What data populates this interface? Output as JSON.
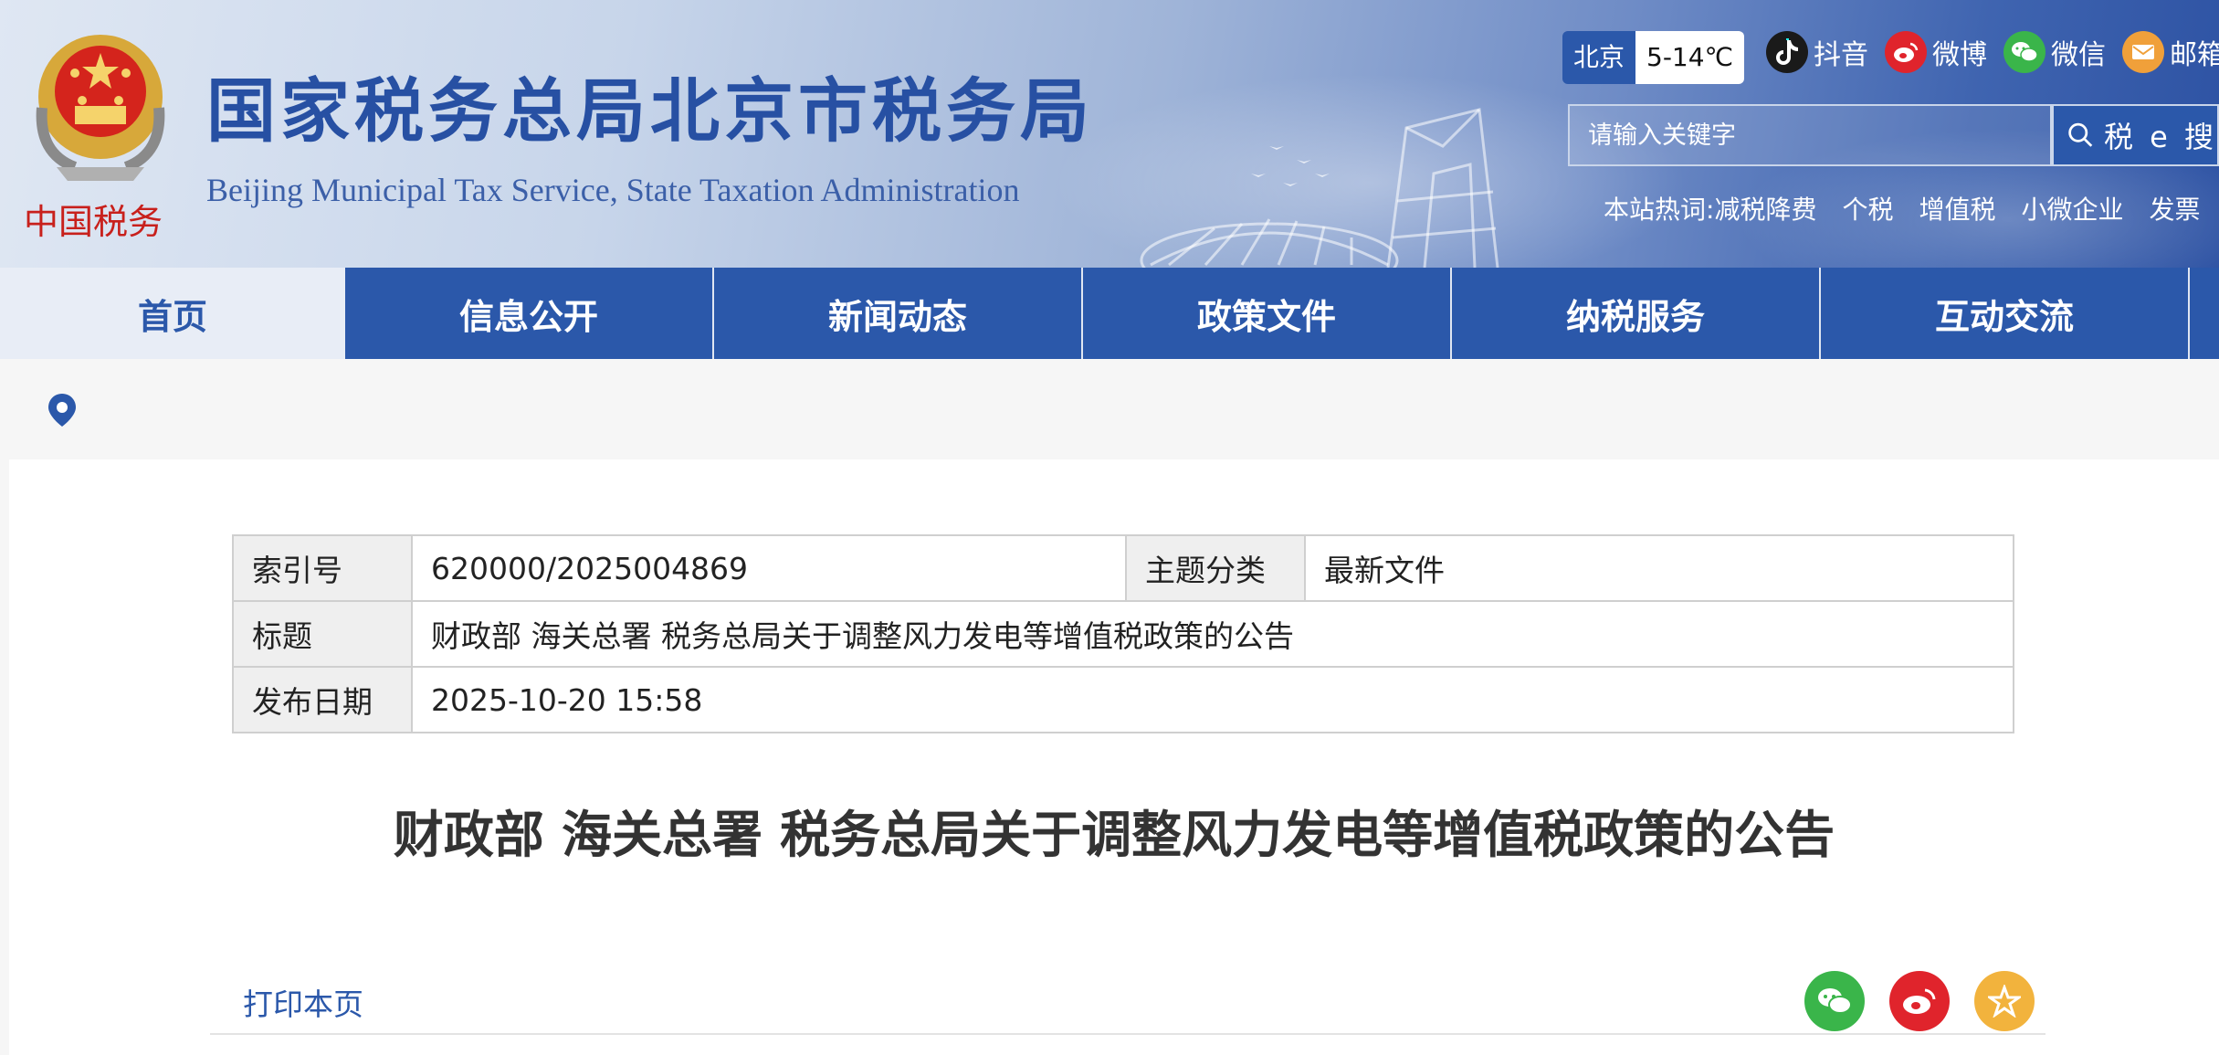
{
  "header": {
    "title_cn": "国家税务总局北京市税务局",
    "title_en": "Beijing Municipal Tax Service, State Taxation Administration",
    "emblem_text": "中国税务"
  },
  "weather": {
    "city": "北京",
    "temp": "5-14℃"
  },
  "social": [
    {
      "label": "抖音",
      "icon": "douyin-icon",
      "color": "#1a1a1a"
    },
    {
      "label": "微博",
      "icon": "weibo-icon",
      "color": "#e0242c"
    },
    {
      "label": "微信",
      "icon": "wechat-icon",
      "color": "#3ab54a"
    },
    {
      "label": "邮箱",
      "icon": "mail-icon",
      "color": "#f0a03a"
    }
  ],
  "search": {
    "placeholder": "请输入关键字",
    "button_label": "税 e 搜"
  },
  "hotwords": {
    "label": "本站热词:",
    "items": [
      "减税降费",
      "个税",
      "增值税",
      "小微企业",
      "发票"
    ]
  },
  "nav": {
    "items": [
      "首页",
      "信息公开",
      "新闻动态",
      "政策文件",
      "纳税服务",
      "互动交流"
    ]
  },
  "meta": {
    "index_label": "索引号",
    "index_value": "620000/2025004869",
    "topic_label": "主题分类",
    "topic_value": "最新文件",
    "title_label": "标题",
    "title_value": "财政部 海关总署 税务总局关于调整风力发电等增值税政策的公告",
    "date_label": "发布日期",
    "date_value": "2025-10-20 15:58"
  },
  "article": {
    "title": "财政部 海关总署 税务总局关于调整风力发电等增值税政策的公告"
  },
  "actions": {
    "print_label": "打印本页"
  },
  "colors": {
    "brand_blue": "#2b58aa",
    "wechat_green": "#3ab54a",
    "weibo_red": "#e0242c",
    "favorite_gold": "#f2b33d"
  }
}
